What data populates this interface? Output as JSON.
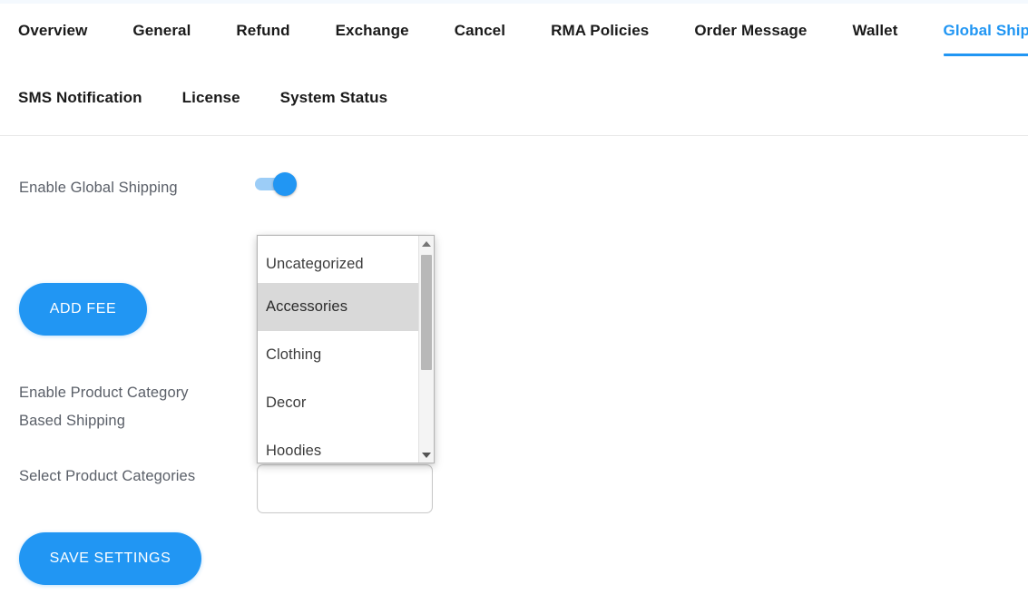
{
  "tabs": {
    "row1": [
      {
        "label": "Overview",
        "active": false
      },
      {
        "label": "General",
        "active": false
      },
      {
        "label": "Refund",
        "active": false
      },
      {
        "label": "Exchange",
        "active": false
      },
      {
        "label": "Cancel",
        "active": false
      },
      {
        "label": "RMA Policies",
        "active": false
      },
      {
        "label": "Order Message",
        "active": false
      },
      {
        "label": "Wallet",
        "active": false
      },
      {
        "label": "Global Shipping",
        "active": true
      }
    ],
    "row2": [
      {
        "label": "SMS Notification",
        "active": false
      },
      {
        "label": "License",
        "active": false
      },
      {
        "label": "System Status",
        "active": false
      }
    ]
  },
  "form": {
    "enable_global_shipping_label": "Enable Global Shipping",
    "enable_global_shipping_value": "on",
    "add_fee_button": "ADD FEE",
    "enable_category_based_label": "Enable Product Category\nBased Shipping",
    "select_categories_label": "Select Product Categories",
    "save_settings_button": "SAVE SETTINGS",
    "selected_categories": []
  },
  "dropdown": {
    "open": true,
    "selected": "Accessories",
    "options": [
      {
        "label": "Uncategorized",
        "selected": false
      },
      {
        "label": "Accessories",
        "selected": true
      },
      {
        "label": "Clothing",
        "selected": false
      },
      {
        "label": "Decor",
        "selected": false
      },
      {
        "label": "Hoodies",
        "selected": false
      }
    ],
    "scroll_up_icon": "triangle-up-icon",
    "scroll_down_icon": "triangle-down-icon"
  },
  "colors": {
    "accent": "#2196f3",
    "toggle_track": "#9ccdf7",
    "label_text": "#5a5f68",
    "tab_text": "#1a1a1a",
    "highlight_row": "#d9d9d9"
  }
}
